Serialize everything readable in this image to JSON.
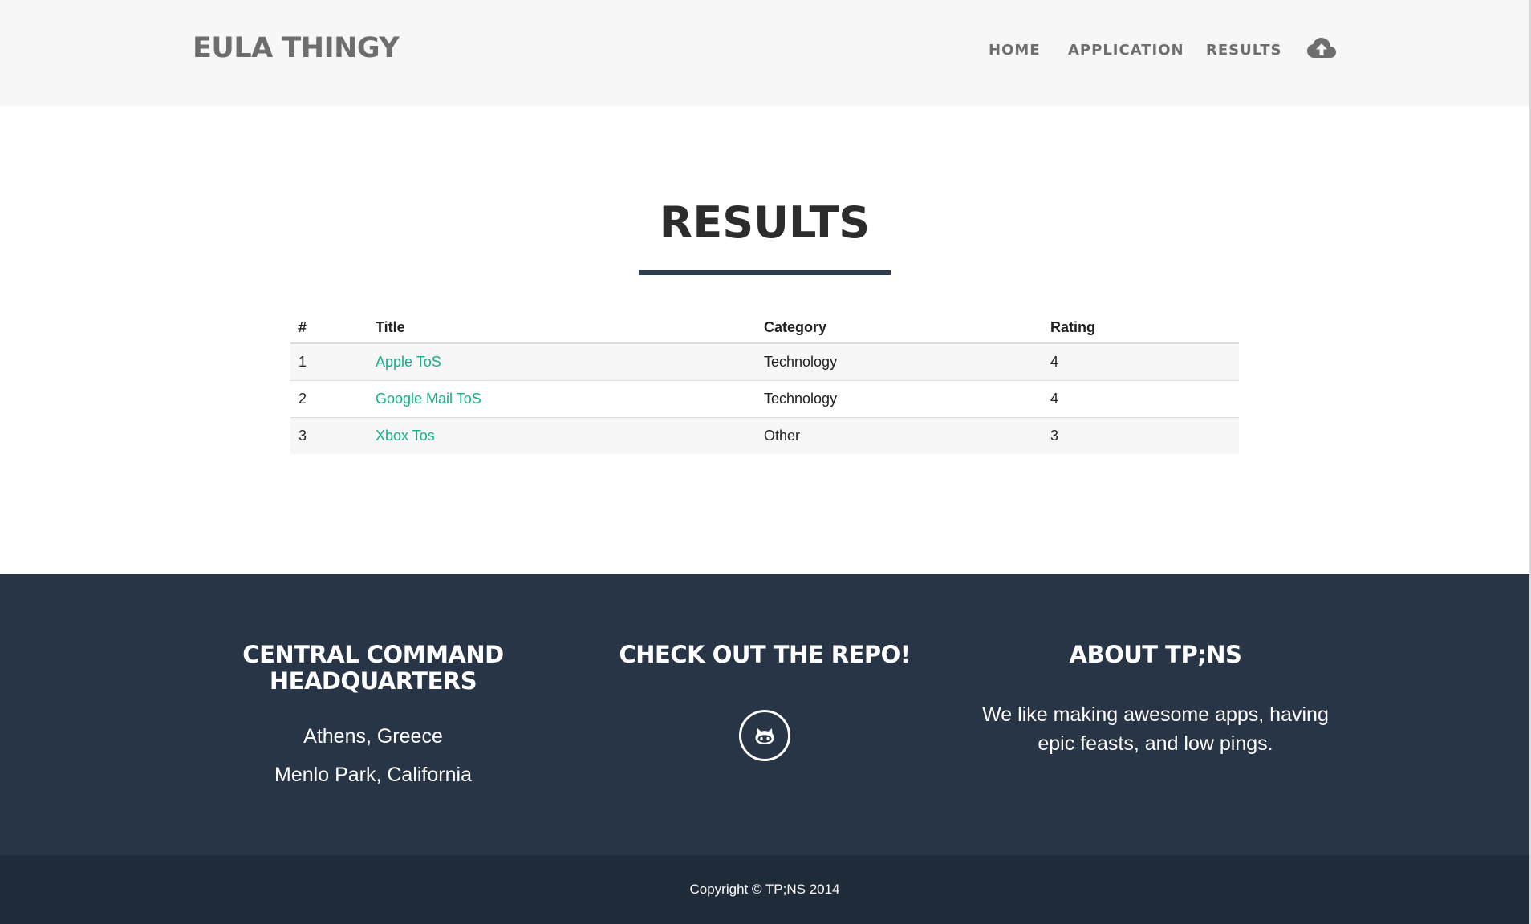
{
  "nav": {
    "brand": "EULA THINGY",
    "links": [
      "HOME",
      "APPLICATION",
      "RESULTS"
    ],
    "upload_icon": "cloud-upload-icon"
  },
  "main": {
    "title": "RESULTS",
    "table": {
      "headers": [
        "#",
        "Title",
        "Category",
        "Rating"
      ],
      "rows": [
        {
          "num": "1",
          "title": "Apple ToS",
          "category": "Technology",
          "rating": "4"
        },
        {
          "num": "2",
          "title": "Google Mail ToS",
          "category": "Technology",
          "rating": "4"
        },
        {
          "num": "3",
          "title": "Xbox Tos",
          "category": "Other",
          "rating": "3"
        }
      ]
    }
  },
  "footer": {
    "col1": {
      "heading_line1": "CENTRAL COMMAND",
      "heading_line2": "HEADQUARTERS",
      "location1": "Athens, Greece",
      "location2": "Menlo Park, California"
    },
    "col2": {
      "heading": "CHECK OUT THE REPO!",
      "icon": "github-icon"
    },
    "col3": {
      "heading": "ABOUT TP;NS",
      "text_line1": "We like making awesome apps, having",
      "text_line2": "epic feasts, and low pings."
    },
    "copyright": "Copyright © TP;NS 2014"
  },
  "colors": {
    "navbar_bg": "#f7f7f7",
    "accent_link": "#18b08a",
    "footer_bg": "#273547",
    "footer_bottom_bg": "#1f2b38",
    "title_rule": "#2c3e50"
  }
}
